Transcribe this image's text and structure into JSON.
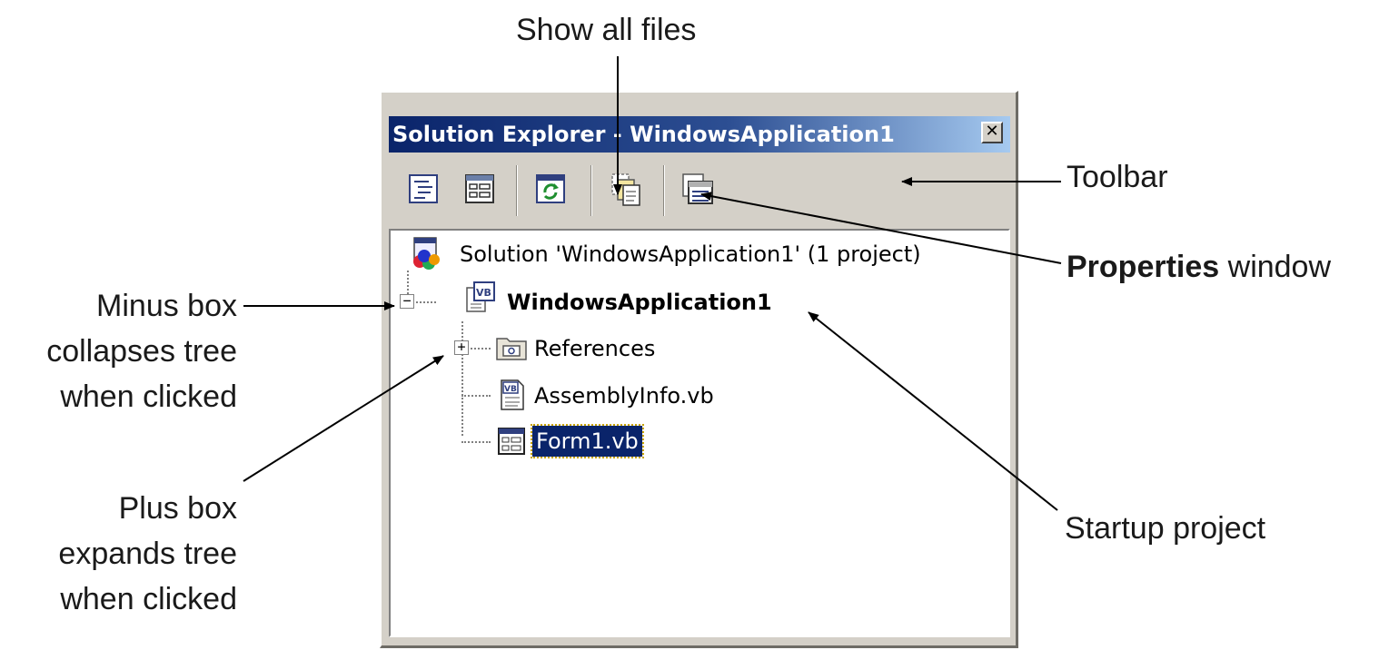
{
  "callouts": {
    "show_all_files": "Show all files",
    "toolbar": "Toolbar",
    "properties_bold": "Properties",
    "properties_rest": " window",
    "minus_box": [
      "Minus box",
      "collapses tree",
      "when clicked"
    ],
    "plus_box": [
      "Plus box",
      "expands tree",
      "when clicked"
    ],
    "startup_project": "Startup project"
  },
  "window": {
    "title": "Solution Explorer - WindowsApplication1",
    "close_glyph": "✕",
    "toolbar_buttons": [
      "view-code-icon",
      "view-designer-icon",
      "refresh-icon",
      "show-all-files-icon",
      "properties-icon"
    ]
  },
  "tree": {
    "solution": "Solution 'WindowsApplication1' (1 project)",
    "project": "WindowsApplication1",
    "expander_minus": "−",
    "expander_plus": "+",
    "items": [
      "References",
      "AssemblyInfo.vb",
      "Form1.vb"
    ]
  },
  "colors": {
    "titlebar_start": "#0a246a",
    "titlebar_end": "#a6caf0",
    "selection": "#0a246a",
    "chrome": "#d4d0c8"
  }
}
